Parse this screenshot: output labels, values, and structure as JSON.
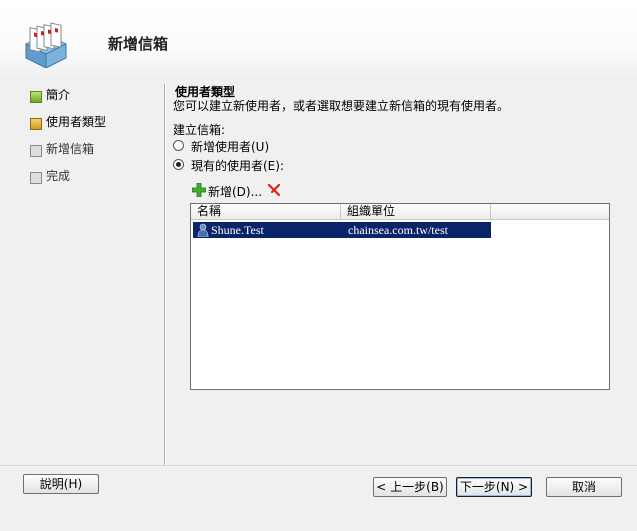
{
  "window": {
    "title": "新增信箱"
  },
  "nav": [
    {
      "label": "簡介",
      "state": "done"
    },
    {
      "label": "使用者類型",
      "state": "active"
    },
    {
      "label": "新增信箱",
      "state": "pending"
    },
    {
      "label": "完成",
      "state": "pending"
    }
  ],
  "section": {
    "title": "使用者類型",
    "description": "您可以建立新使用者，或者選取想要建立新信箱的現有使用者。"
  },
  "create_mailbox": {
    "label": "建立信箱:",
    "options": [
      {
        "label": "新增使用者(U)",
        "selected": false
      },
      {
        "label": "現有的使用者(E):",
        "selected": true
      }
    ]
  },
  "toolbar": {
    "add_label": "新增(D)...",
    "add_icon": "plus-icon",
    "delete_icon": "red-x-icon"
  },
  "users_table": {
    "columns": [
      "名稱",
      "組織單位"
    ],
    "rows": [
      {
        "name": "Shune.Test",
        "ou": "chainsea.com.tw/test",
        "selected": true
      }
    ]
  },
  "buttons": {
    "help": "說明(H)",
    "back": "< 上一步(B)",
    "next": "下一步(N) >",
    "cancel": "取消"
  },
  "colors": {
    "selection": "#0a246a",
    "accent": "#d29a18",
    "done": "#6ca71e"
  }
}
